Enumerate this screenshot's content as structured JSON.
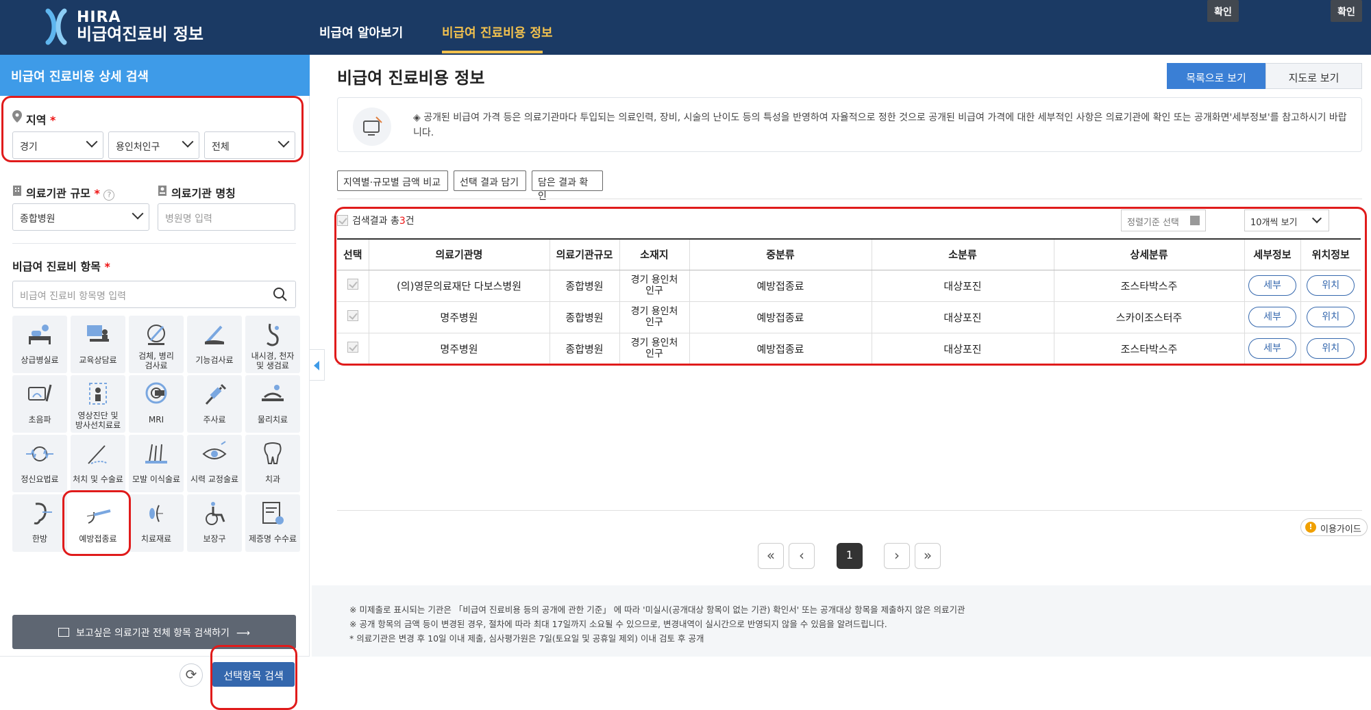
{
  "header": {
    "logo_line1": "HIRA",
    "logo_line2": "비급여진료비 정보",
    "nav": [
      "비급여 알아보기",
      "비급여 진료비용 정보"
    ],
    "active_nav": 1,
    "colors": {
      "header_bg": "#1b3a64",
      "active": "#f2c14e"
    }
  },
  "sidebar": {
    "title": "비급여 진료비용 상세 검색",
    "region_label": "지역",
    "region_selects": [
      "경기",
      "용인처인구",
      "전체"
    ],
    "scale_label": "의료기관 규모",
    "scale_value": "종합병원",
    "name_label": "의료기관 명칭",
    "name_placeholder": "병원명 입력",
    "item_label": "비급여 진료비 항목",
    "item_placeholder": "비급여 진료비 항목명 입력",
    "categories": [
      [
        "상급병실료"
      ],
      [
        "교육상담료"
      ],
      [
        "검체, 병리",
        "검사료"
      ],
      [
        "기능검사료"
      ],
      [
        "내시경, 천자",
        "및 생검료"
      ],
      [
        "초음파"
      ],
      [
        "영상진단 및",
        "방사선치료료"
      ],
      [
        "MRI"
      ],
      [
        "주사료"
      ],
      [
        "물리치료"
      ],
      [
        "정신요법료"
      ],
      [
        "처치 및 수술료"
      ],
      [
        "모발 이식술료"
      ],
      [
        "시력 교정술료"
      ],
      [
        "치과"
      ],
      [
        "한방"
      ],
      [
        "예방접종료"
      ],
      [
        "치료재료"
      ],
      [
        "보장구"
      ],
      [
        "제증명 수수료"
      ]
    ],
    "selected_category": "예방접종료",
    "full_search_button": "보고싶은 의료기관 전체 항목 검색하기",
    "search_button": "선택항목 검색"
  },
  "main": {
    "title": "비급여 진료비용 정보",
    "view_tabs": [
      "목록으로 보기",
      "지도로 보기"
    ],
    "notice": "◈ 공개된 비급여 가격 등은 의료기관마다 투입되는 의료인력, 장비, 시술의 난이도 등의 특성을 반영하여 자율적으로 정한 것으로 공개된 비급여 가격에 대한 세부적인 사항은 의료기관에 확인 또는 공개화면'세부정보'를 참고하시기 바랍니다.",
    "action_buttons": [
      "지역별·규모별 금액 비교",
      "선택 결과 담기",
      "담은 결과 확인"
    ],
    "result_prefix": "검색결과 총",
    "result_count": "3",
    "result_suffix": "건",
    "sort_placeholder": "정렬기준 선택",
    "confirm": "확인",
    "page_size": "10개씩 보기",
    "columns": [
      "선택",
      "의료기관명",
      "의료기관규모",
      "소재지",
      "중분류",
      "소분류",
      "상세분류",
      "세부정보",
      "위치정보"
    ],
    "rows": [
      {
        "name": "(의)영문의료재단 다보스병원",
        "scale": "종합병원",
        "loc1": "경기 용인처",
        "loc2": "인구",
        "mid": "예방접종료",
        "small": "대상포진",
        "detail": "조스타박스주",
        "btn1": "세부",
        "btn2": "위치"
      },
      {
        "name": "명주병원",
        "scale": "종합병원",
        "loc1": "경기 용인처",
        "loc2": "인구",
        "mid": "예방접종료",
        "small": "대상포진",
        "detail": "스카이조스터주",
        "btn1": "세부",
        "btn2": "위치"
      },
      {
        "name": "명주병원",
        "scale": "종합병원",
        "loc1": "경기 용인처",
        "loc2": "인구",
        "mid": "예방접종료",
        "small": "대상포진",
        "detail": "조스타박스주",
        "btn1": "세부",
        "btn2": "위치"
      }
    ],
    "guide": "이용가이드",
    "pagination": {
      "current": "1",
      "first": "«",
      "prev": "‹",
      "next": "›",
      "last": "»"
    },
    "footnotes": [
      "※ 미제출로 표시되는 기관은 「비급여 진료비용 등의 공개에 관한 기준」 에 따라 '미실시(공개대상 항목이 없는 기관) 확인서' 또는 공개대상 항목을 제출하지 않은 의료기관",
      "※ 공개 항목의 금액 등이 변경된 경우, 절차에 따라 최대 17일까지 소요될 수 있으므로, 변경내역이 실시간으로 반영되지 않을 수 있음을 알려드립니다.",
      "* 의료기관은 변경 후 10일 이내 제출, 심사평가원은 7일(토요일 및 공휴일 제외) 이내 검토 후 공개"
    ]
  }
}
